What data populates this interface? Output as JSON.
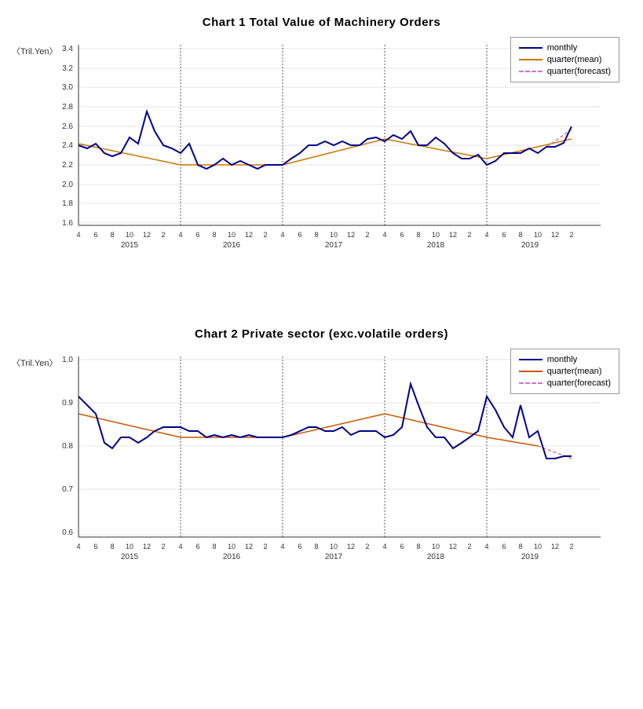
{
  "chart1": {
    "title": "Chart 1  Total Value of Machinery Orders",
    "yLabel": "〈Tril.Yen〉",
    "yMin": 1.6,
    "yMax": 3.4,
    "yTicks": [
      3.4,
      3.2,
      3.0,
      2.8,
      2.6,
      2.4,
      2.2,
      2.0,
      1.8,
      1.6
    ],
    "legend": {
      "monthly": "monthly",
      "quarterMean": "quarter(mean)",
      "quarterForecast": "quarter(forecast)"
    }
  },
  "chart2": {
    "title": "Chart 2  Private sector (exc.volatile orders)",
    "yLabel": "〈Tril.Yen〉",
    "yMin": 0.6,
    "yMax": 1.0,
    "yTicks": [
      1.0,
      0.9,
      0.8,
      0.7,
      0.6
    ],
    "legend": {
      "monthly": "monthly",
      "quarterMean": "quarter(mean)",
      "quarterForecast": "quarter(forecast)"
    }
  },
  "xLabels": {
    "years": [
      "2015",
      "2016",
      "2017",
      "2018",
      "2019"
    ],
    "months": [
      "4",
      "6",
      "8",
      "10",
      "12",
      "2"
    ]
  }
}
